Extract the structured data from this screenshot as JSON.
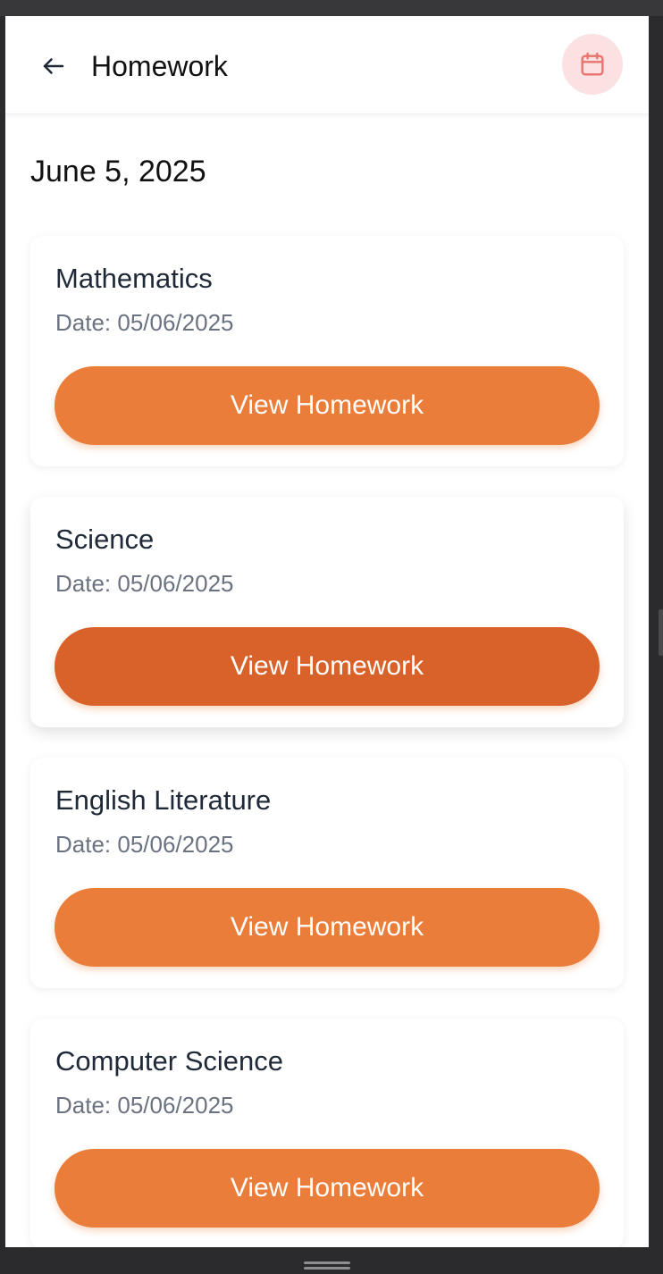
{
  "header": {
    "title": "Homework",
    "back_icon": "arrow-left-icon",
    "calendar_icon": "calendar-icon"
  },
  "date_heading": "June 5, 2025",
  "cards": [
    {
      "subject": "Mathematics",
      "date": "Date: 05/06/2025",
      "button_label": "View Homework"
    },
    {
      "subject": "Science",
      "date": "Date: 05/06/2025",
      "button_label": "View Homework",
      "state": "pressed"
    },
    {
      "subject": "English Literature",
      "date": "Date: 05/06/2025",
      "button_label": "View Homework"
    },
    {
      "subject": "Computer Science",
      "date": "Date: 05/06/2025",
      "button_label": "View Homework"
    }
  ],
  "colors": {
    "accent": "#e97d39",
    "accent_pressed": "#d9622a",
    "calendar_bg": "#fbe1e1",
    "calendar_icon": "#e8736f",
    "text_primary": "#1f2937",
    "text_secondary": "#6b7280"
  }
}
